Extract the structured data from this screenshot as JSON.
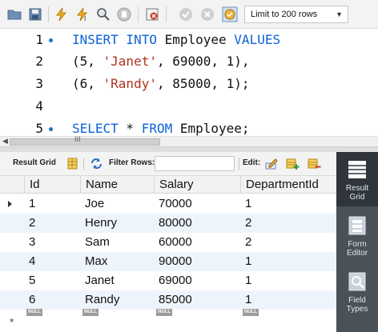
{
  "toolbar": {
    "buttons": [
      "open-file",
      "save",
      "execute",
      "execute-current",
      "explain",
      "stop",
      "toggle-error",
      "commit",
      "rollback",
      "autocommit"
    ],
    "limit": {
      "selected": "Limit to 200 rows"
    }
  },
  "editor": {
    "lines": [
      {
        "num": "1",
        "marker": true
      },
      {
        "num": "2",
        "marker": false
      },
      {
        "num": "3",
        "marker": false
      },
      {
        "num": "4",
        "marker": false
      },
      {
        "num": "5",
        "marker": true
      }
    ],
    "l1": {
      "kw1": "INSERT INTO",
      "t1": " Employee ",
      "kw2": "VALUES"
    },
    "l2": {
      "a": "(5, ",
      "s": "'Janet'",
      "b": ", 69000, 1),"
    },
    "l3": {
      "a": "(6, ",
      "s": "'Randy'",
      "b": ", 85000, 1);"
    },
    "l5": {
      "kw1": "SELECT",
      "t1": " * ",
      "kw2": "FROM",
      "t2": " Employee;"
    }
  },
  "hscroll": {
    "grip": "III"
  },
  "result_toolbar": {
    "result_grid": "Result Grid",
    "filter_rows": "Filter Rows:",
    "filter_value": "",
    "edit": "Edit:"
  },
  "grid": {
    "columns": [
      "Id",
      "Name",
      "Salary",
      "DepartmentId"
    ],
    "rows": [
      [
        "1",
        "Joe",
        "70000",
        "1"
      ],
      [
        "2",
        "Henry",
        "80000",
        "2"
      ],
      [
        "3",
        "Sam",
        "60000",
        "2"
      ],
      [
        "4",
        "Max",
        "90000",
        "1"
      ],
      [
        "5",
        "Janet",
        "69000",
        "1"
      ],
      [
        "6",
        "Randy",
        "85000",
        "1"
      ]
    ],
    "null_label": "NULL",
    "new_row_marker": "*"
  },
  "side_panel": [
    {
      "label": "Result\nGrid",
      "icon": "result-grid-icon",
      "active": true
    },
    {
      "label": "Form\nEditor",
      "icon": "form-editor-icon",
      "active": false
    },
    {
      "label": "Field\nTypes",
      "icon": "field-types-icon",
      "active": false
    }
  ],
  "colors": {
    "keyword": "#0b62d6",
    "string": "#b1321f",
    "side_panel": "#4a5159",
    "alt_row": "#eef4fb"
  }
}
